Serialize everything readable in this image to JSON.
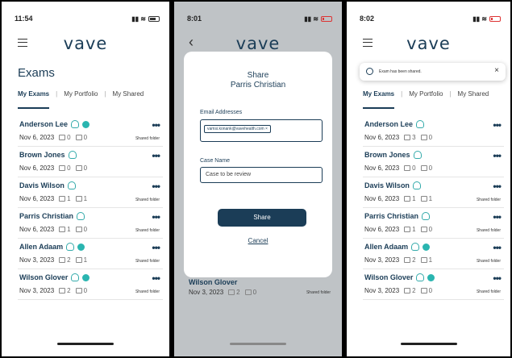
{
  "logo": "vave",
  "screen1": {
    "time": "11:54",
    "title": "Exams",
    "tabs": [
      "My Exams",
      "My Portfolio",
      "My Shared"
    ],
    "rows": [
      {
        "name": "Anderson Lee",
        "date": "Nov 6, 2023",
        "c1": "0",
        "c2": "0",
        "shared": "Shared folder"
      },
      {
        "name": "Brown Jones",
        "date": "Nov 6, 2023",
        "c1": "0",
        "c2": "0",
        "shared": ""
      },
      {
        "name": "Davis Wilson",
        "date": "Nov 6, 2023",
        "c1": "1",
        "c2": "1",
        "shared": "Shared folder"
      },
      {
        "name": "Parris Christian",
        "date": "Nov 6, 2023",
        "c1": "1",
        "c2": "0",
        "shared": "Shared folder"
      },
      {
        "name": "Allen Adaam",
        "date": "Nov 3, 2023",
        "c1": "2",
        "c2": "1",
        "shared": "Shared folder"
      },
      {
        "name": "Wilson Glover",
        "date": "Nov 3, 2023",
        "c1": "2",
        "c2": "0",
        "shared": "Shared folder"
      }
    ]
  },
  "screen2": {
    "time": "8:01",
    "modal_title": "Share",
    "modal_sub": "Parris Christian",
    "email_label": "Email Addresses",
    "email_chip": "vamsi.konank@vavehealth.com ×",
    "case_label": "Case Name",
    "case_value": "Case to be review",
    "share_btn": "Share",
    "cancel_btn": "Cancel",
    "bg_name": "Wilson Glover",
    "bg_date": "Nov 3, 2023",
    "bg_c1": "2",
    "bg_c2": "0",
    "bg_shared": "Shared folder"
  },
  "screen3": {
    "time": "8:02",
    "toast": "Exam has been shared.",
    "tabs": [
      "My Exams",
      "My Portfolio",
      "My Shared"
    ],
    "rows": [
      {
        "name": "Anderson Lee",
        "date": "Nov 6, 2023",
        "c1": "3",
        "c2": "0",
        "shared": ""
      },
      {
        "name": "Brown Jones",
        "date": "Nov 6, 2023",
        "c1": "0",
        "c2": "0",
        "shared": ""
      },
      {
        "name": "Davis Wilson",
        "date": "Nov 6, 2023",
        "c1": "1",
        "c2": "1",
        "shared": "Shared folder"
      },
      {
        "name": "Parris Christian",
        "date": "Nov 6, 2023",
        "c1": "1",
        "c2": "0",
        "shared": "Shared folder"
      },
      {
        "name": "Allen Adaam",
        "date": "Nov 3, 2023",
        "c1": "2",
        "c2": "1",
        "shared": "Shared folder"
      },
      {
        "name": "Wilson Glover",
        "date": "Nov 3, 2023",
        "c1": "2",
        "c2": "0",
        "shared": "Shared folder"
      }
    ]
  }
}
